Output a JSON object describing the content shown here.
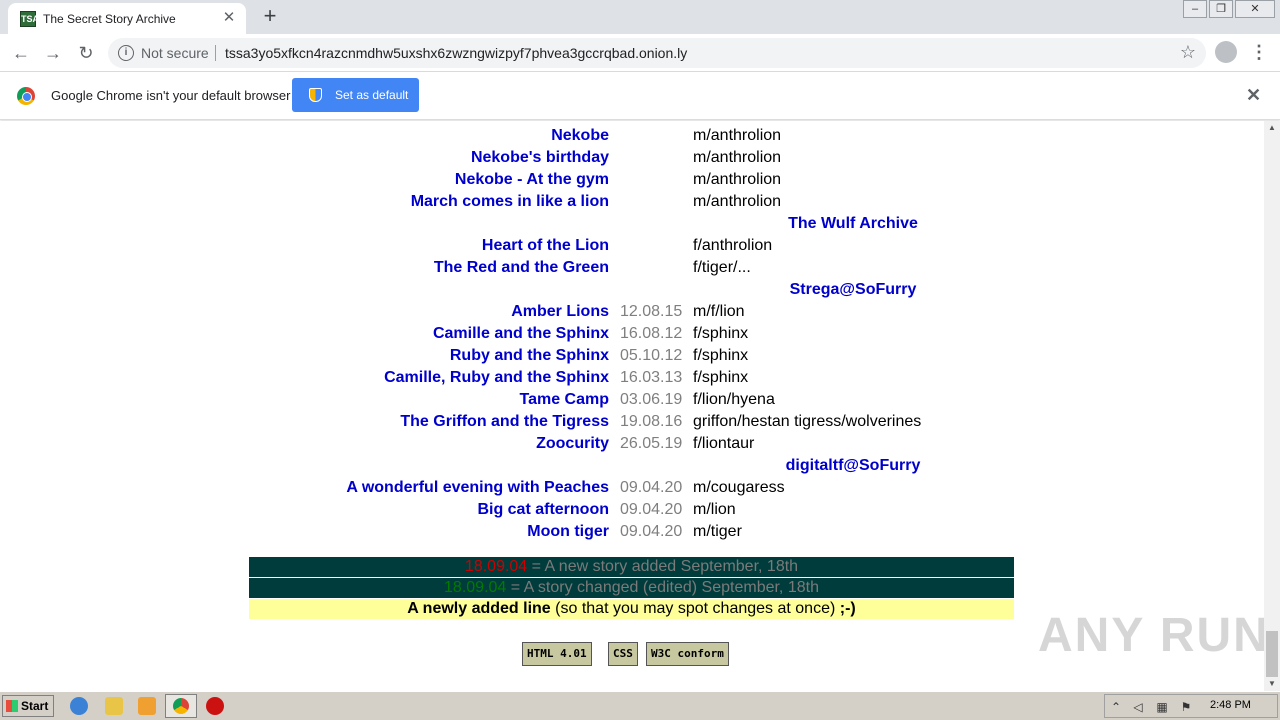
{
  "browser": {
    "tab_title": "The Secret Story Archive",
    "tab_favicon_text": "TSA",
    "not_secure": "Not secure",
    "url": "tssa3yo5xfkcn4razcnmdhw5uxshx6zwzngwizpyf7phvea3gccrqbad.onion.ly",
    "infobar_text": "Google Chrome isn't your default browser",
    "set_default_label": "Set as default"
  },
  "stories": [
    {
      "type": "story",
      "title": "Nekobe",
      "date": "",
      "tags": "m/anthrolion"
    },
    {
      "type": "story",
      "title": "Nekobe's birthday",
      "date": "",
      "tags": "m/anthrolion"
    },
    {
      "type": "story",
      "title": "Nekobe - At the gym",
      "date": "",
      "tags": "m/anthrolion"
    },
    {
      "type": "story",
      "title": "March comes in like a lion",
      "date": "",
      "tags": "m/anthrolion"
    },
    {
      "type": "section",
      "title": "The Wulf Archive"
    },
    {
      "type": "story",
      "title": "Heart of the Lion",
      "date": "",
      "tags": "f/anthrolion"
    },
    {
      "type": "story",
      "title": "The Red and the Green",
      "date": "",
      "tags": "f/tiger/..."
    },
    {
      "type": "section",
      "title": "Strega@SoFurry"
    },
    {
      "type": "story",
      "title": "Amber Lions",
      "date": "12.08.15",
      "tags": "m/f/lion"
    },
    {
      "type": "story",
      "title": "Camille and the Sphinx",
      "date": "16.08.12",
      "tags": "f/sphinx"
    },
    {
      "type": "story",
      "title": "Ruby and the Sphinx",
      "date": "05.10.12",
      "tags": "f/sphinx"
    },
    {
      "type": "story",
      "title": "Camille, Ruby and the Sphinx",
      "date": "16.03.13",
      "tags": "f/sphinx"
    },
    {
      "type": "story",
      "title": "Tame Camp",
      "date": "03.06.19",
      "tags": "f/lion/hyena"
    },
    {
      "type": "story",
      "title": "The Griffon and the Tigress",
      "date": "19.08.16",
      "tags": "griffon/hestan tigress/wolverines"
    },
    {
      "type": "story",
      "title": "Zoocurity",
      "date": "26.05.19",
      "tags": "f/liontaur"
    },
    {
      "type": "section",
      "title": "digitaltf@SoFurry"
    },
    {
      "type": "story",
      "title": "A wonderful evening with Peaches",
      "date": "09.04.20",
      "tags": "m/cougaress"
    },
    {
      "type": "story",
      "title": "Big cat afternoon",
      "date": "09.04.20",
      "tags": "m/lion"
    },
    {
      "type": "story",
      "title": "Moon tiger",
      "date": "09.04.20",
      "tags": "m/tiger"
    }
  ],
  "legend": {
    "new_date": "18.09.04",
    "new_text": " = A new story added September, 18th",
    "changed_date": "18.09.04",
    "changed_text": " = A story changed (edited) September, 18th",
    "newline_bold": "A newly added line",
    "newline_rest": " (so that you may spot changes at once) ",
    "newline_smiley": ";-)"
  },
  "badges": [
    "HTML 4.01",
    "CSS",
    "W3C conform"
  ],
  "watermark": "ANY RUN",
  "taskbar": {
    "start_label": "Start",
    "clock": "2:48 PM"
  },
  "colors": {
    "link": "#0000cc",
    "legend_dark": "#003c3c",
    "legend_yellow": "#ffff99",
    "new_red": "#cc0000",
    "changed_green": "#007a00"
  }
}
